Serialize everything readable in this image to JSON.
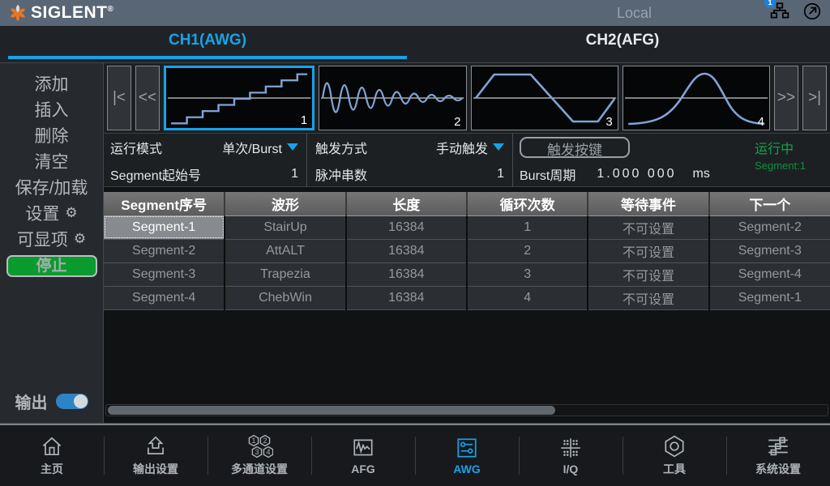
{
  "topbar": {
    "brand": "SIGLENT",
    "reg": "®",
    "status": "Local",
    "lan_badge": "1"
  },
  "tabs": [
    {
      "label": "CH1(AWG)",
      "active": true
    },
    {
      "label": "CH2(AFG)",
      "active": false
    }
  ],
  "sidebar": {
    "items": [
      {
        "label": "添加"
      },
      {
        "label": "插入"
      },
      {
        "label": "删除"
      },
      {
        "label": "清空"
      },
      {
        "label": "保存/加载"
      },
      {
        "label": "设置"
      },
      {
        "label": "可显项"
      }
    ],
    "stop_label": "停止",
    "output_label": "输出",
    "output_on": true
  },
  "strip": {
    "first": "|<",
    "prev": "<<",
    "next": ">>",
    "last": ">|",
    "thumbs": [
      {
        "num": "1",
        "wave": "StairUp",
        "selected": true
      },
      {
        "num": "2",
        "wave": "AttALT",
        "selected": false
      },
      {
        "num": "3",
        "wave": "Trapezia",
        "selected": false
      },
      {
        "num": "4",
        "wave": "ChebWin",
        "selected": false
      }
    ]
  },
  "settings": {
    "run_mode_label": "运行模式",
    "run_mode_value": "单次/Burst",
    "trigger_mode_label": "触发方式",
    "trigger_mode_value": "手动触发",
    "trigger_key_button": "触发按键",
    "seg_start_label": "Segment起始号",
    "seg_start_value": "1",
    "pulse_count_label": "脉冲串数",
    "pulse_count_value": "1",
    "burst_period_label": "Burst周期",
    "burst_period_value": "1.000 000",
    "burst_period_unit": "ms",
    "running_status": "运行中",
    "running_segment": "Segment:1"
  },
  "table": {
    "headers": [
      "Segment序号",
      "波形",
      "长度",
      "循环次数",
      "等待事件",
      "下一个"
    ],
    "rows": [
      [
        "Segment-1",
        "StairUp",
        "16384",
        "1",
        "不可设置",
        "Segment-2"
      ],
      [
        "Segment-2",
        "AttALT",
        "16384",
        "2",
        "不可设置",
        "Segment-3"
      ],
      [
        "Segment-3",
        "Trapezia",
        "16384",
        "3",
        "不可设置",
        "Segment-4"
      ],
      [
        "Segment-4",
        "ChebWin",
        "16384",
        "4",
        "不可设置",
        "Segment-1"
      ]
    ],
    "selected_cell": "Segment-1"
  },
  "nav": {
    "items": [
      {
        "label": "主页",
        "active": false
      },
      {
        "label": "输出设置",
        "active": false
      },
      {
        "label": "多通道设置",
        "active": false
      },
      {
        "label": "AFG",
        "active": false
      },
      {
        "label": "AWG",
        "active": true
      },
      {
        "label": "I/Q",
        "active": false
      },
      {
        "label": "工具",
        "active": false
      },
      {
        "label": "系统设置",
        "active": false
      }
    ]
  },
  "colors": {
    "accent": "#18a2e8",
    "running_green": "#14a24a",
    "stop_green": "#0a9b2e",
    "wave_blue": "#7fa3d4",
    "topbar_gray": "#596676"
  }
}
